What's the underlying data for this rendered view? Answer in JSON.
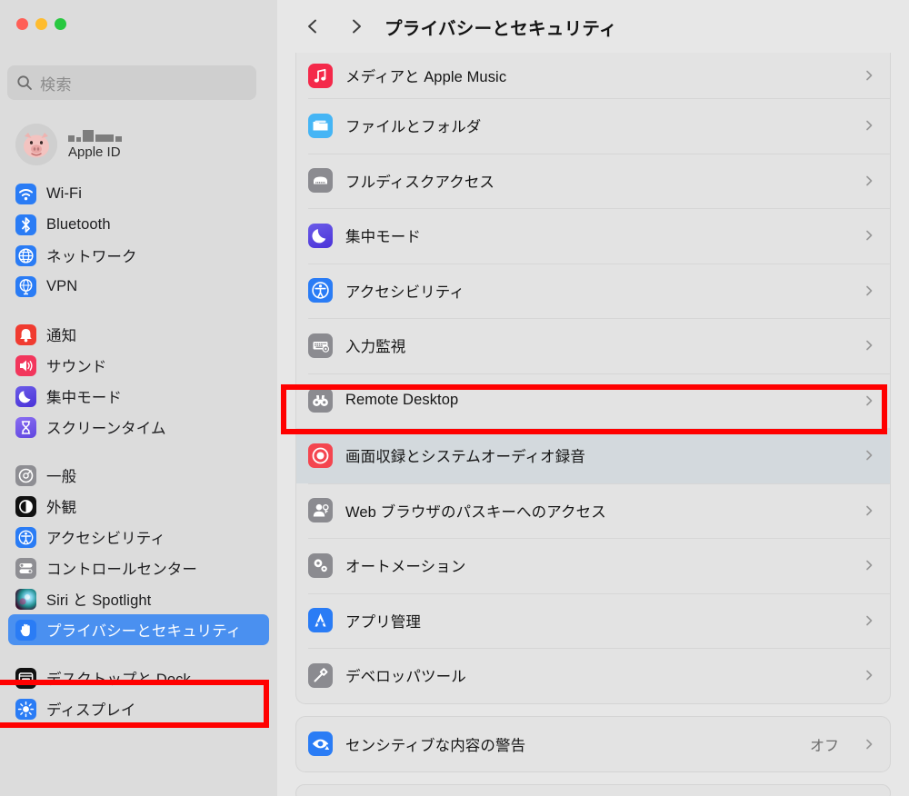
{
  "window": {
    "traffic_lights": [
      "close",
      "minimize",
      "zoom"
    ]
  },
  "sidebar": {
    "search": {
      "placeholder": "検索",
      "value": "",
      "icon": "search-icon"
    },
    "account": {
      "name_redacted": true,
      "label": "Apple ID",
      "avatar_icon": "pig-memoji-avatar"
    },
    "groups": [
      {
        "items": [
          {
            "label": "Wi-Fi",
            "icon": "wifi-icon",
            "color": "#2a7cf5"
          },
          {
            "label": "Bluetooth",
            "icon": "bluetooth-icon",
            "color": "#2a7cf5"
          },
          {
            "label": "ネットワーク",
            "icon": "network-globe-icon",
            "color": "#2a7cf5"
          },
          {
            "label": "VPN",
            "icon": "vpn-globe-icon",
            "color": "#2a7cf5"
          }
        ]
      },
      {
        "items": [
          {
            "label": "通知",
            "icon": "notifications-bell-icon",
            "color": "#f03b30"
          },
          {
            "label": "サウンド",
            "icon": "sound-speaker-icon",
            "color": "#f2365c"
          },
          {
            "label": "集中モード",
            "icon": "focus-moon-icon",
            "color": "#5b4be0"
          },
          {
            "label": "スクリーンタイム",
            "icon": "screen-time-hourglass-icon",
            "color": "#6f5be6"
          }
        ]
      },
      {
        "items": [
          {
            "label": "一般",
            "icon": "general-gear-icon",
            "color": "#8e8e93"
          },
          {
            "label": "外観",
            "icon": "appearance-contrast-icon",
            "color": "#111111"
          },
          {
            "label": "アクセシビリティ",
            "icon": "accessibility-icon",
            "color": "#2a7cf5"
          },
          {
            "label": "コントロールセンター",
            "icon": "control-center-icon",
            "color": "#8e8e93"
          },
          {
            "label": "Siri と Spotlight",
            "icon": "siri-spotlight-icon",
            "color": "#3a3a3c"
          },
          {
            "label": "プライバシーとセキュリティ",
            "icon": "privacy-hand-icon",
            "color": "#2a7cf5",
            "selected": true
          }
        ]
      },
      {
        "items": [
          {
            "label": "デスクトップと Dock",
            "icon": "desktop-dock-icon",
            "color": "#111111"
          },
          {
            "label": "ディスプレイ",
            "icon": "display-brightness-icon",
            "color": "#2a7cf5"
          }
        ]
      }
    ]
  },
  "header": {
    "back_icon": "chevron-left-icon",
    "forward_icon": "chevron-right-icon",
    "title": "プライバシーとセキュリティ"
  },
  "main": {
    "cards": [
      {
        "clipped_top": true,
        "rows": [
          {
            "label": "メディアと Apple Music",
            "icon": "music-note-icon",
            "color": "#f4294a",
            "value": "",
            "chevron": true
          },
          {
            "label": "ファイルとフォルダ",
            "icon": "folder-icon",
            "color": "#45b5f5",
            "value": "",
            "chevron": true
          },
          {
            "label": "フルディスクアクセス",
            "icon": "hard-drive-icon",
            "color": "#8b8b90",
            "value": "",
            "chevron": true
          },
          {
            "label": "集中モード",
            "icon": "focus-moon-icon",
            "color": "#5b4be0",
            "value": "",
            "chevron": true
          },
          {
            "label": "アクセシビリティ",
            "icon": "accessibility-icon",
            "color": "#2a7cf5",
            "value": "",
            "chevron": true
          },
          {
            "label": "入力監視",
            "icon": "keyboard-monitor-icon",
            "color": "#8b8b90",
            "value": "",
            "chevron": true
          },
          {
            "label": "Remote Desktop",
            "icon": "binoculars-icon",
            "color": "#8b8b90",
            "value": "",
            "chevron": true
          },
          {
            "label": "画面収録とシステムオーディオ録音",
            "icon": "screen-record-icon",
            "color": "#f4454f",
            "value": "",
            "chevron": true,
            "highlighted": true
          },
          {
            "label": "Web ブラウザのパスキーへのアクセス",
            "icon": "passkey-person-icon",
            "color": "#8b8b90",
            "value": "",
            "chevron": true
          },
          {
            "label": "オートメーション",
            "icon": "automation-gears-icon",
            "color": "#8b8b90",
            "value": "",
            "chevron": true
          },
          {
            "label": "アプリ管理",
            "icon": "app-management-icon",
            "color": "#2a7cf5",
            "value": "",
            "chevron": true
          },
          {
            "label": "デベロッパツール",
            "icon": "developer-hammer-icon",
            "color": "#8b8b90",
            "value": "",
            "chevron": true
          }
        ]
      },
      {
        "rows": [
          {
            "label": "センシティブな内容の警告",
            "icon": "sensitive-content-eye-icon",
            "color": "#2a7cf5",
            "value": "オフ",
            "chevron": true
          }
        ]
      },
      {
        "rows": []
      }
    ]
  },
  "annotations": [
    {
      "name": "sidebar-privacy-highlight",
      "color": "#ff0000"
    },
    {
      "name": "screen-recording-row-highlight",
      "color": "#ff0000"
    }
  ]
}
